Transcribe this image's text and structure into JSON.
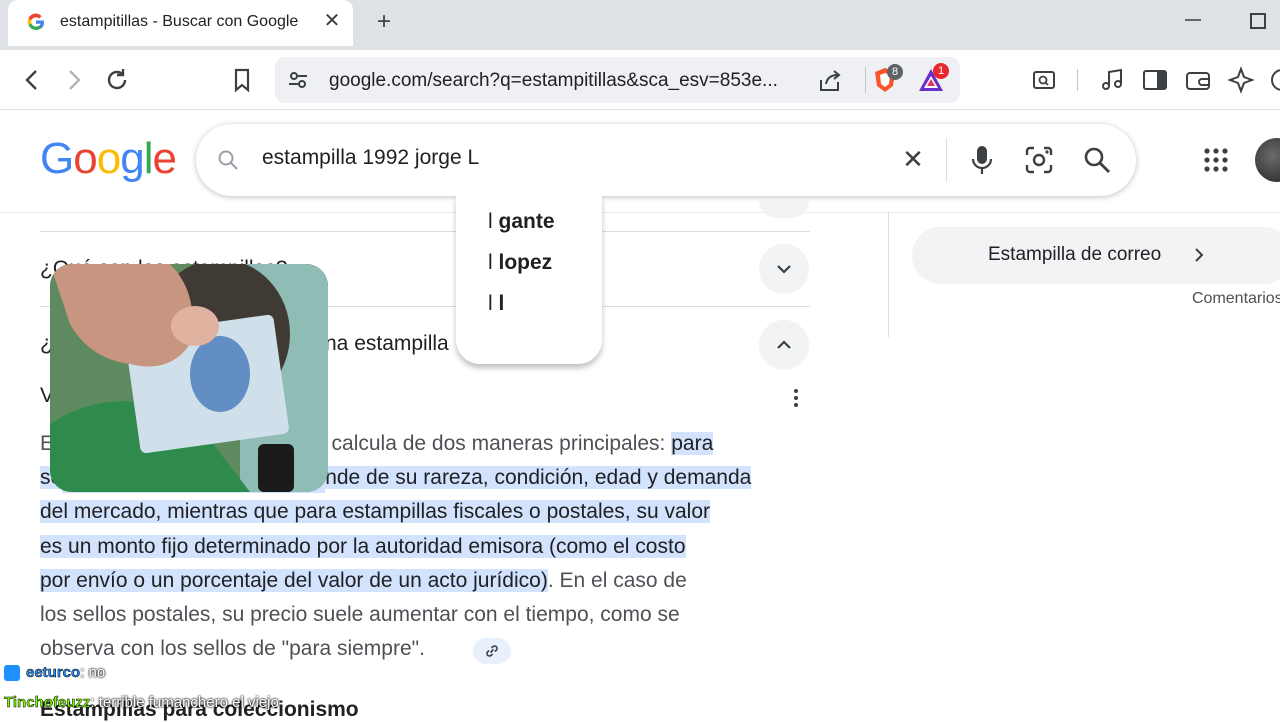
{
  "browser": {
    "tab_title": "estampitillas - Buscar con Google",
    "tab_close": "✕",
    "new_tab": "+",
    "url": "google.com/search?q=estampitillas&sca_esv=853e...",
    "brave_badge": "8",
    "rewards_badge": "1"
  },
  "google": {
    "logo_letters": [
      "G",
      "o",
      "o",
      "g",
      "l",
      "e"
    ],
    "logo_colors": [
      "#4285f4",
      "#ea4335",
      "#fbbc05",
      "#4285f4",
      "#34a853",
      "#ea4335"
    ],
    "query": "estampilla 1992 jorge L",
    "clear": "✕"
  },
  "suggestions": [
    {
      "prefix": "l",
      "bold": " gante"
    },
    {
      "prefix": "l",
      "bold": " lopez"
    },
    {
      "prefix": "l",
      "bold": " l"
    }
  ],
  "questions": [
    {
      "text": "¿Qué son las estampillas?",
      "expanded": false
    },
    {
      "text": "¿Cuál es el valor de una estampilla?",
      "visible_suffix": "na estampilla",
      "expanded": true
    }
  ],
  "answer": {
    "lead_letter_1": "V",
    "line1_prefix": "E",
    "line1_mid": "e calcula de dos maneras principales: ",
    "line1_hl": "para",
    "line2_prefix": "se",
    "line2_hl": "nde de su rareza, condición, edad y demanda",
    "line3_hl": "del mercado, mientras que para estampillas fiscales o postales, su valor",
    "line4_hl": "es un monto fijo determinado por la autoridad emisora (como el costo",
    "line5_hl": "por envío o un porcentaje del valor de un acto jurídico)",
    "line5_rest": ". En el caso de",
    "line6": "los sellos postales, su precio suele aumentar con el tiempo, como se",
    "line7": "observa con los sellos de \"para siempre\"."
  },
  "right_panel": {
    "chip_label": "Estampilla de correo",
    "comentarios": "Comentarios"
  },
  "next_heading": "Estampillas para coleccionismo",
  "chat": [
    {
      "user": "eeturco",
      "user_color": "#1e90ff",
      "msg": ": no"
    },
    {
      "user": "Tinchofeuzz",
      "user_color": "#7cfc00",
      "msg": ": terrible fumanchero el viejo"
    }
  ]
}
